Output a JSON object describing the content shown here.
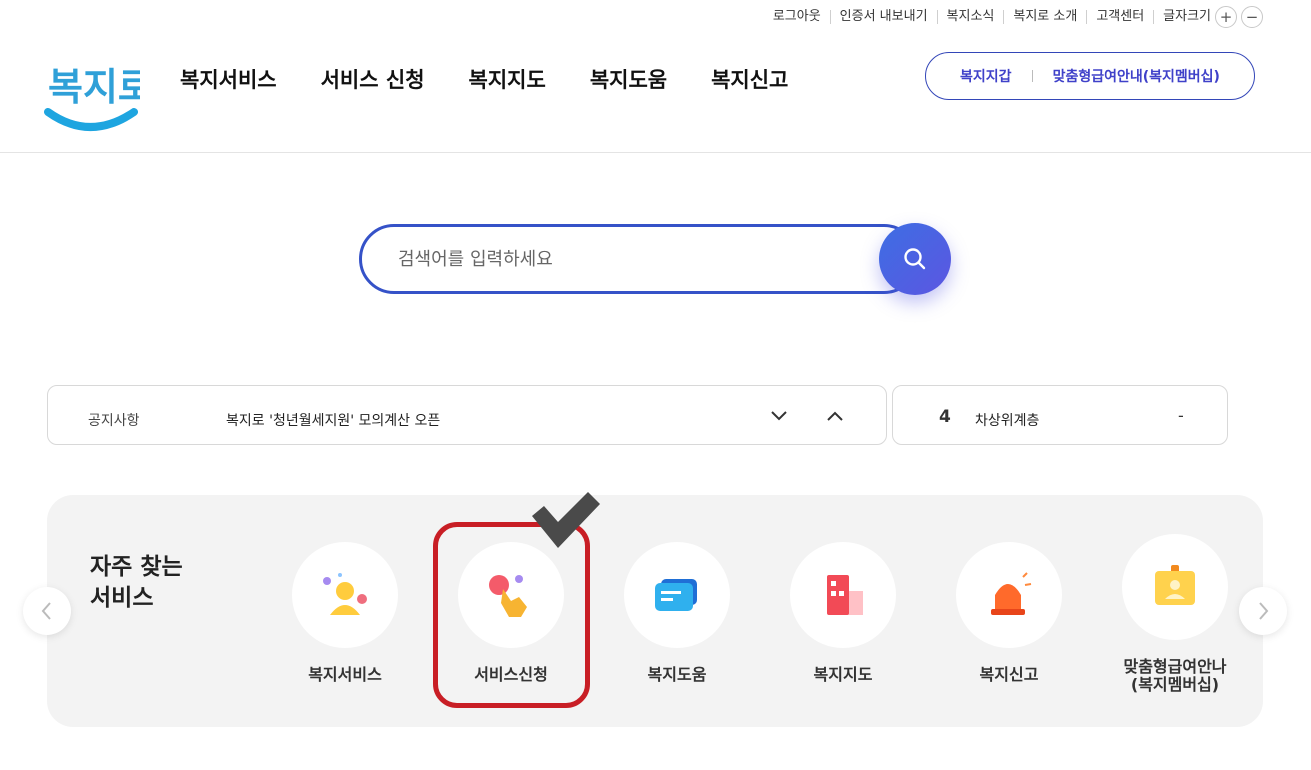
{
  "utility_nav": {
    "links": [
      "로그아웃",
      "인증서 내보내기",
      "복지소식",
      "복지로 소개",
      "고객센터"
    ],
    "font_size_label": "글자크기",
    "font_increase": "+",
    "font_decrease": "−"
  },
  "header": {
    "logo_text": "복지로",
    "nav": [
      "복지서비스",
      "서비스 신청",
      "복지지도",
      "복지도움",
      "복지신고"
    ],
    "pill_links": [
      "복지지갑",
      "맞춤형급여안내(복지멤버십)"
    ]
  },
  "search": {
    "placeholder": "검색어를 입력하세요",
    "value": ""
  },
  "notice": {
    "label": "공지사항",
    "text": "복지로 '청년월세지원' 모의계산 오픈"
  },
  "ranking": {
    "number": "4",
    "keyword": "차상위계층",
    "change": "-"
  },
  "frequent": {
    "title_line1": "자주 찾는",
    "title_line2": "서비스",
    "items": [
      {
        "label": "복지서비스",
        "icon": "person-icon"
      },
      {
        "label": "서비스신청",
        "icon": "touch-hand-icon"
      },
      {
        "label": "복지도움",
        "icon": "chat-bubble-icon"
      },
      {
        "label": "복지지도",
        "icon": "building-map-icon"
      },
      {
        "label": "복지신고",
        "icon": "siren-icon"
      },
      {
        "label": "맞춤형급여안나\n(복지멤버십)",
        "label_line1": "맞춤형급여안나",
        "label_line2": "(복지멤버십)",
        "icon": "id-badge-icon"
      }
    ]
  },
  "colors": {
    "brand_blue": "#3346b8",
    "accent_purple": "#5c56e2",
    "highlight_red": "#c81e25"
  }
}
